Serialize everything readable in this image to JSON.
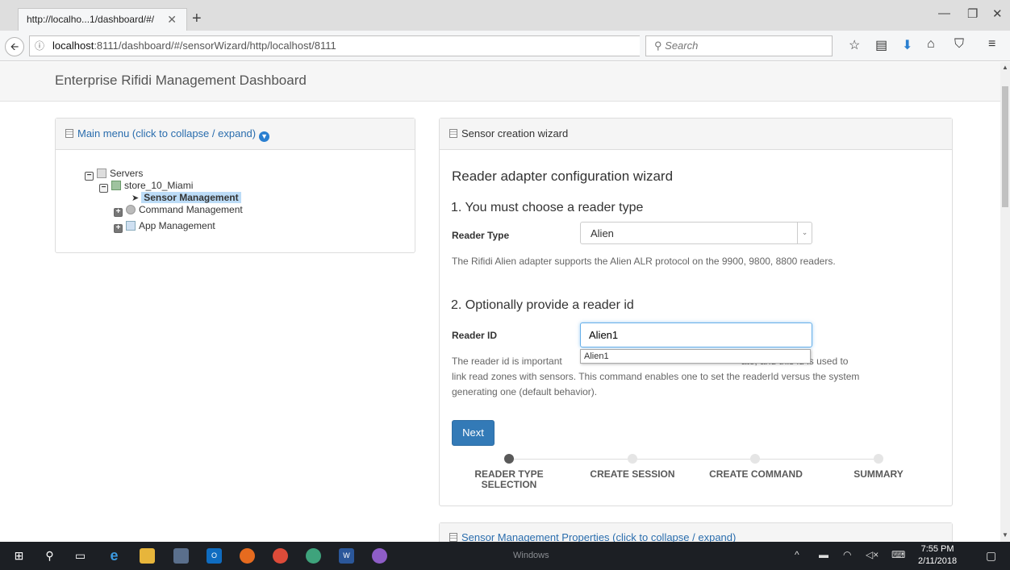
{
  "browser": {
    "tab_title": "http://localho...1/dashboard/#/",
    "tab_close": "✕",
    "new_tab": "+",
    "url_host": "localhost",
    "url_rest": ":8111/dashboard/#/sensorWizard/http/localhost/8111",
    "search_placeholder": "Search",
    "window_controls": {
      "minimize": "—",
      "restore": "❐",
      "close": "✕"
    }
  },
  "app": {
    "title": "Enterprise Rifidi Management Dashboard"
  },
  "main_menu": {
    "heading": "Main menu (click to collapse / expand)",
    "tree": {
      "servers": "Servers",
      "store": "store_10_Miami",
      "sensor": "Sensor Management",
      "command": "Command Management",
      "app": "App Management"
    }
  },
  "wizard": {
    "panel_heading": "Sensor creation wizard",
    "title": "Reader adapter configuration wizard",
    "step1_heading": "1. You must choose a reader type",
    "reader_type_label": "Reader Type",
    "reader_type_value": "Alien",
    "reader_type_help": "The Rifidi Alien adapter supports the Alien ALR protocol on the 9900, 9800, 8800 readers.",
    "step2_heading": "2. Optionally provide a reader id",
    "reader_id_label": "Reader ID",
    "reader_id_value": "Alien1",
    "autocomplete_option": "Alien1",
    "reader_id_help_a": "The reader id is important",
    "reader_id_help_b": "ate, and this id is used to",
    "reader_id_help_c": "link read zones with sensors. This command enables one to set the readerId versus the system",
    "reader_id_help_d": "generating one (default behavior).",
    "next_label": "Next",
    "steps": [
      {
        "label_1": "READER TYPE",
        "label_2": "SELECTION",
        "active": true
      },
      {
        "label_1": "CREATE SESSION",
        "active": false
      },
      {
        "label_1": "CREATE COMMAND",
        "active": false
      },
      {
        "label_1": "SUMMARY",
        "active": false
      }
    ]
  },
  "properties_panel": {
    "heading": "Sensor Management Properties (click to collapse / expand)"
  },
  "taskbar": {
    "windows_label": "Windows",
    "time": "7:55 PM",
    "date": "2/11/2018"
  }
}
